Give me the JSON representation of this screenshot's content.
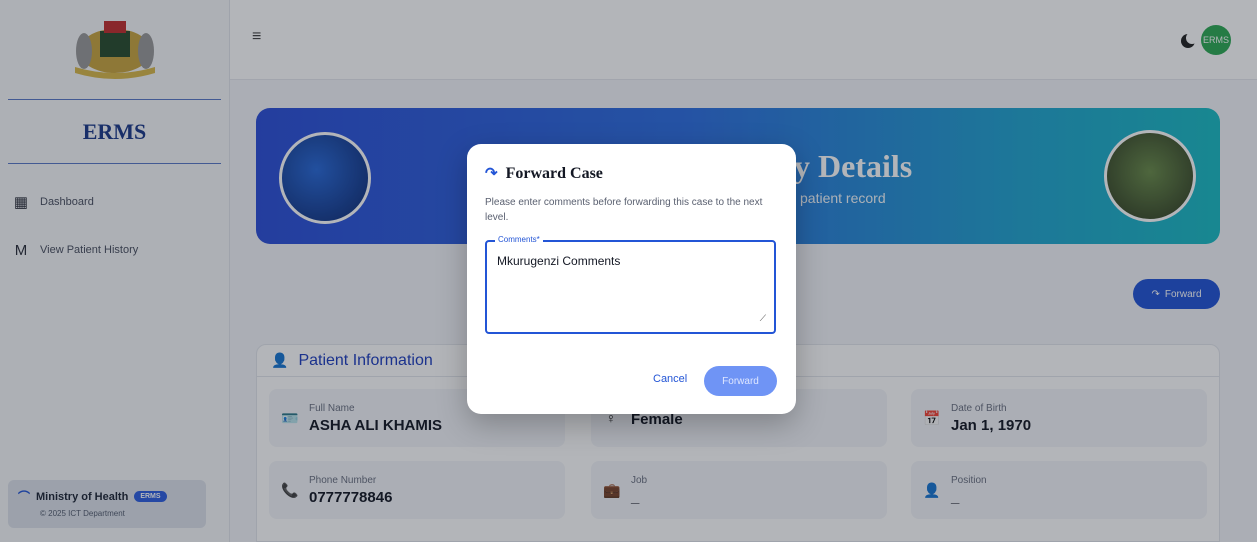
{
  "sidebar": {
    "brand": "ERMS",
    "items": [
      {
        "label": "Dashboard",
        "icon": "dashboard-icon",
        "glyph": "▦"
      },
      {
        "label": "View Patient History",
        "icon": "m-icon",
        "glyph": "M"
      }
    ],
    "footer": {
      "title": "Ministry of Health",
      "badge": "ERMS",
      "sub": "© 2025 ICT Department"
    }
  },
  "topbar": {
    "avatar": "ERMS"
  },
  "banner": {
    "title": "y Details",
    "subtitle": "patient record"
  },
  "actions": {
    "forward_label": "Forward"
  },
  "patient": {
    "section_title": "Patient Information",
    "fields": [
      {
        "label": "Full Name",
        "value": "ASHA ALI KHAMIS",
        "icon": "id-card-icon",
        "glyph": "🪪"
      },
      {
        "label": "",
        "value": "Female",
        "icon": "gender-icon",
        "glyph": "♀"
      },
      {
        "label": "Date of Birth",
        "value": "Jan 1, 1970",
        "icon": "calendar-icon",
        "glyph": "📅"
      },
      {
        "label": "Phone Number",
        "value": "0777778846",
        "icon": "phone-icon",
        "glyph": "📞"
      },
      {
        "label": "Job",
        "value": "_",
        "icon": "briefcase-icon",
        "glyph": "💼"
      },
      {
        "label": "Position",
        "value": "_",
        "icon": "position-icon",
        "glyph": "👤"
      }
    ]
  },
  "modal": {
    "title": "Forward Case",
    "description": "Please enter comments before forwarding this case to the next level.",
    "comments_label": "Comments*",
    "comments_value": "Mkurugenzi Comments",
    "cancel_label": "Cancel",
    "forward_label": "Forward"
  },
  "colors": {
    "primary": "#2355d6",
    "brand": "#1c3a8a"
  }
}
